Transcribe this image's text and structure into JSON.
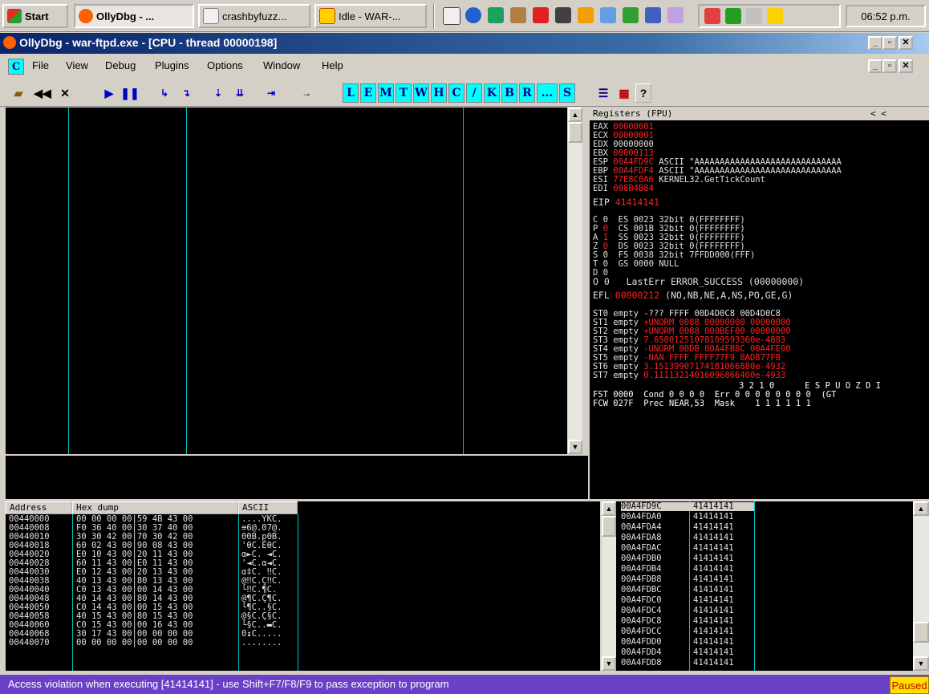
{
  "taskbar": {
    "start_label": "Start",
    "buttons": [
      {
        "label": "OllyDbg - ..."
      },
      {
        "label": "crashbyfuzz..."
      },
      {
        "label": "Idle - WAR-..."
      }
    ],
    "clock": "06:52 p.m."
  },
  "window": {
    "title": "OllyDbg - war-ftpd.exe - [CPU - thread 00000198]"
  },
  "menu": {
    "items": [
      "File",
      "View",
      "Debug",
      "Plugins",
      "Options",
      "Window",
      "Help"
    ],
    "mdi_icon_letter": "C"
  },
  "toolbar": {
    "letters": [
      "L",
      "E",
      "M",
      "T",
      "W",
      "H",
      "C",
      "/",
      "K",
      "B",
      "R",
      "...",
      "S"
    ],
    "help_label": "?"
  },
  "registers": {
    "title": "Registers (FPU)",
    "nav": "<   <",
    "gp": [
      {
        "name": "EAX",
        "value": "00000001",
        "comment": ""
      },
      {
        "name": "ECX",
        "value": "00000001",
        "comment": ""
      },
      {
        "name": "EDX",
        "value": "00000000",
        "comment": ""
      },
      {
        "name": "EBX",
        "value": "00000113",
        "comment": ""
      },
      {
        "name": "ESP",
        "value": "00A4FD9C",
        "comment": "ASCII \"AAAAAAAAAAAAAAAAAAAAAAAAAAAAA"
      },
      {
        "name": "EBP",
        "value": "00A4FDF4",
        "comment": "ASCII \"AAAAAAAAAAAAAAAAAAAAAAAAAAAAA"
      },
      {
        "name": "ESI",
        "value": "77E8C0A6",
        "comment": "KERNEL32.GetTickCount"
      },
      {
        "name": "EDI",
        "value": "008B4B84",
        "comment": ""
      }
    ],
    "eip": {
      "name": "EIP",
      "value": "41414141"
    },
    "flags": [
      {
        "f": "C",
        "v": "0",
        "seg": "ES 0023 32bit 0(FFFFFFFF)"
      },
      {
        "f": "P",
        "v": "0",
        "seg": "CS 001B 32bit 0(FFFFFFFF)"
      },
      {
        "f": "A",
        "v": "1",
        "seg": "SS 0023 32bit 0(FFFFFFFF)"
      },
      {
        "f": "Z",
        "v": "0",
        "seg": "DS 0023 32bit 0(FFFFFFFF)"
      },
      {
        "f": "S",
        "v": "0",
        "seg": "FS 0038 32bit 7FFDD000(FFF)"
      },
      {
        "f": "T",
        "v": "0",
        "seg": "GS 0000 NULL"
      },
      {
        "f": "D",
        "v": "0",
        "seg": ""
      },
      {
        "f": "O",
        "v": "0",
        "seg": "LastErr ERROR_SUCCESS (00000000)"
      }
    ],
    "efl": {
      "name": "EFL",
      "value": "00000212",
      "comment": "(NO,NB,NE,A,NS,PO,GE,G)"
    },
    "fpu": [
      {
        "name": "ST0",
        "state": "empty",
        "value": "-??? FFFF 00D4D0C8 00D4D0C8"
      },
      {
        "name": "ST1",
        "state": "empty",
        "value": "+UNORM 0088 00000000 00000000"
      },
      {
        "name": "ST2",
        "state": "empty",
        "value": "+UNORM 0088 000BEF00 00000000"
      },
      {
        "name": "ST3",
        "state": "empty",
        "value": "7.65001251078109593360e-4883"
      },
      {
        "name": "ST4",
        "state": "empty",
        "value": "-UNORM 00DB 00A4FB8C 00A4FE00"
      },
      {
        "name": "ST5",
        "state": "empty",
        "value": "-NAN FFFF FFFF77F9 8AD877FB"
      },
      {
        "name": "ST6",
        "state": "empty",
        "value": "3.15139907174181066880e-4932"
      },
      {
        "name": "ST7",
        "state": "empty",
        "value": "0.11113214016096866400e-4933"
      }
    ],
    "fpu_bits_header": "3 2 1 0      E S P U O Z D I",
    "fst": "FST 0000  Cond 0 0 0 0  Err 0 0 0 0 0 0 0 0  (GT",
    "fcw": "FCW 027F  Prec NEAR,53  Mask    1 1 1 1 1 1"
  },
  "dump": {
    "headers": [
      "Address",
      "Hex dump",
      "ASCII"
    ],
    "rows": [
      {
        "addr": "00440000",
        "hex": "00 00 00 00|59 4B 43 00",
        "ascii": "....YKC."
      },
      {
        "addr": "00440008",
        "hex": "F0 36 40 00|30 37 40 00",
        "ascii": "≡6@.07@."
      },
      {
        "addr": "00440010",
        "hex": "30 30 42 00|70 30 42 00",
        "ascii": "00B.p0B."
      },
      {
        "addr": "00440018",
        "hex": "60 02 43 00|90 08 43 00",
        "ascii": "'θC.ÉθC."
      },
      {
        "addr": "00440020",
        "hex": "E0 10 43 00|20 11 43 00",
        "ascii": "α►C. ◄C."
      },
      {
        "addr": "00440028",
        "hex": "60 11 43 00|E0 11 43 00",
        "ascii": "'◄C.α◄C."
      },
      {
        "addr": "00440030",
        "hex": "E0 12 43 00|20 13 43 00",
        "ascii": "α‡C. ‼C."
      },
      {
        "addr": "00440038",
        "hex": "40 13 43 00|80 13 43 00",
        "ascii": "@‼C.Ç‼C."
      },
      {
        "addr": "00440040",
        "hex": "C0 13 43 00|00 14 43 00",
        "ascii": "└‼C.¶C."
      },
      {
        "addr": "00440048",
        "hex": "40 14 43 00|80 14 43 00",
        "ascii": "@¶C.Ç¶C."
      },
      {
        "addr": "00440050",
        "hex": "C0 14 43 00|00 15 43 00",
        "ascii": "└¶C..§C."
      },
      {
        "addr": "00440058",
        "hex": "40 15 43 00|80 15 43 00",
        "ascii": "@§C.Ç§C."
      },
      {
        "addr": "00440060",
        "hex": "C0 15 43 00|00 16 43 00",
        "ascii": "└§C..▬C."
      },
      {
        "addr": "00440068",
        "hex": "30 17 43 00|00 00 00 00",
        "ascii": "0↨C....."
      },
      {
        "addr": "00440070",
        "hex": "00 00 00 00|00 00 00 00",
        "ascii": "........"
      }
    ]
  },
  "stack": {
    "rows": [
      {
        "addr": "00A4FD9C",
        "value": "41414141",
        "selected": true
      },
      {
        "addr": "00A4FDA0",
        "value": "41414141"
      },
      {
        "addr": "00A4FDA4",
        "value": "41414141"
      },
      {
        "addr": "00A4FDA8",
        "value": "41414141"
      },
      {
        "addr": "00A4FDAC",
        "value": "41414141"
      },
      {
        "addr": "00A4FDB0",
        "value": "41414141"
      },
      {
        "addr": "00A4FDB4",
        "value": "41414141"
      },
      {
        "addr": "00A4FDB8",
        "value": "41414141"
      },
      {
        "addr": "00A4FDBC",
        "value": "41414141"
      },
      {
        "addr": "00A4FDC0",
        "value": "41414141"
      },
      {
        "addr": "00A4FDC4",
        "value": "41414141"
      },
      {
        "addr": "00A4FDC8",
        "value": "41414141"
      },
      {
        "addr": "00A4FDCC",
        "value": "41414141"
      },
      {
        "addr": "00A4FDD0",
        "value": "41414141"
      },
      {
        "addr": "00A4FDD4",
        "value": "41414141"
      },
      {
        "addr": "00A4FDD8",
        "value": "41414141"
      }
    ]
  },
  "status": {
    "text": "Access violation when executing [41414141] - use Shift+F7/F8/F9 to pass exception to program",
    "state": "Paused"
  }
}
